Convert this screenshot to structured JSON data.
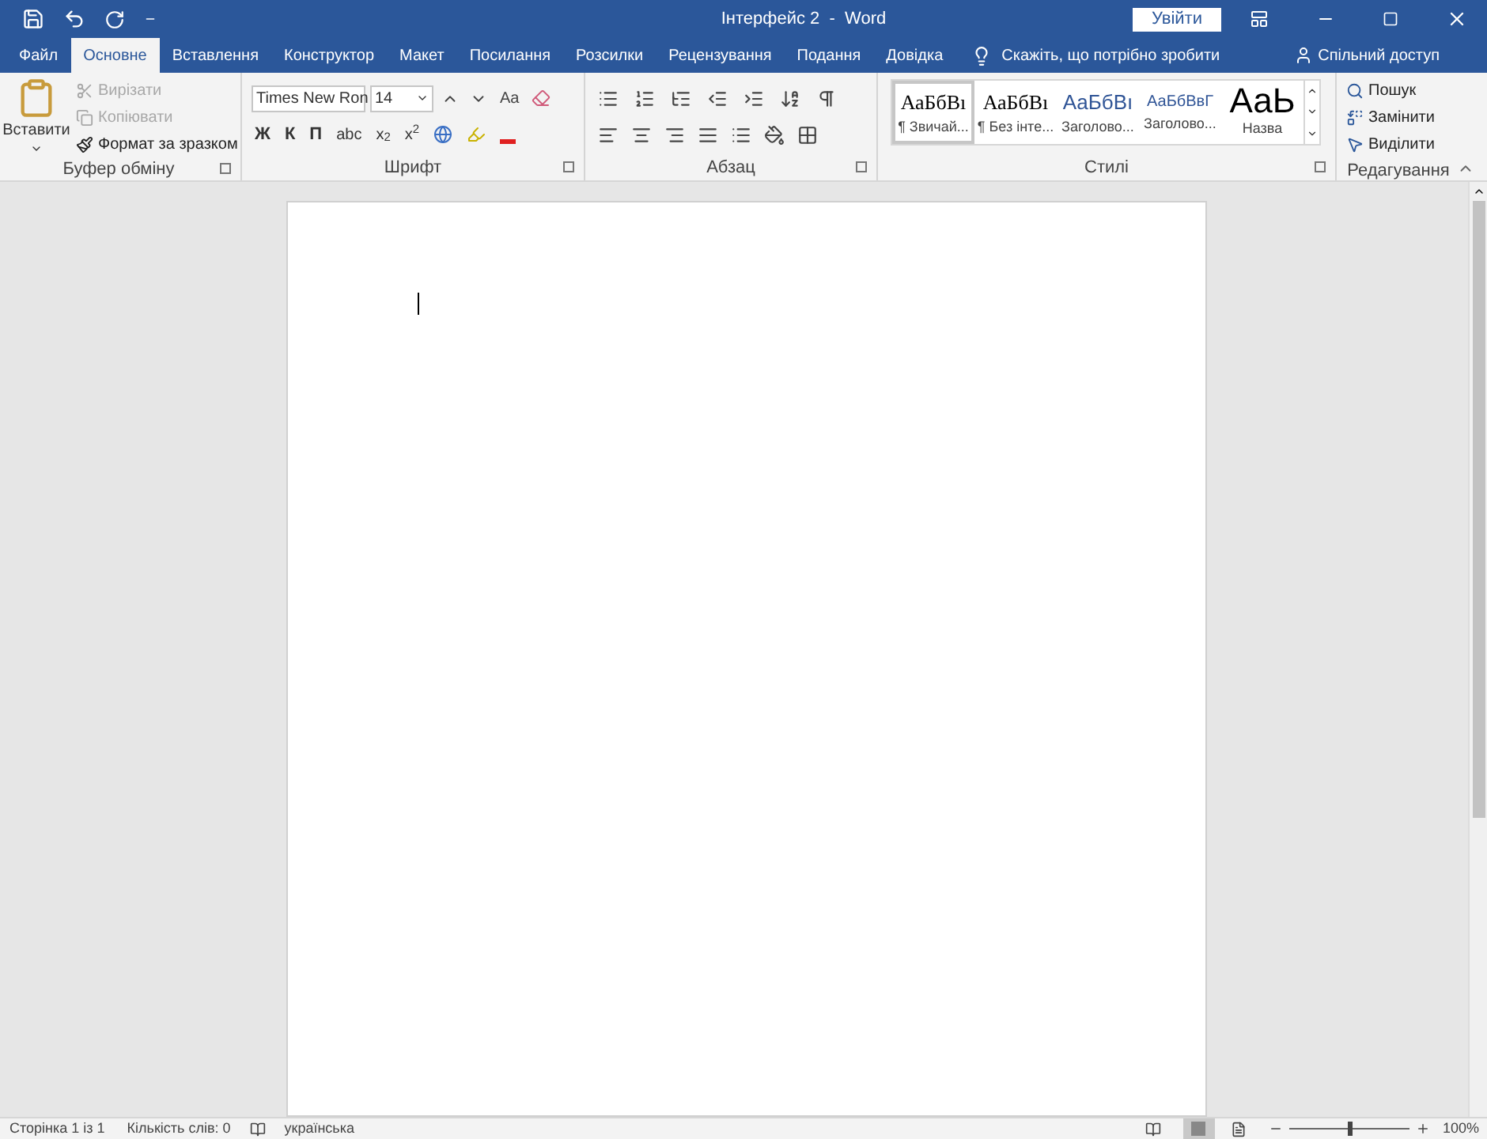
{
  "title_bar": {
    "title": "Інтерфейс 2  -  Word",
    "sign_in": "Увійти"
  },
  "tabs": [
    {
      "label": "Файл",
      "selected": false
    },
    {
      "label": "Основне",
      "selected": true
    },
    {
      "label": "Вставлення",
      "selected": false
    },
    {
      "label": "Конструктор",
      "selected": false
    },
    {
      "label": "Макет",
      "selected": false
    },
    {
      "label": "Посилання",
      "selected": false
    },
    {
      "label": "Розсилки",
      "selected": false
    },
    {
      "label": "Рецензування",
      "selected": false
    },
    {
      "label": "Подання",
      "selected": false
    },
    {
      "label": "Довідка",
      "selected": false
    }
  ],
  "tell_me": "Скажіть, що потрібно зробити",
  "share": "Спільний доступ",
  "clipboard": {
    "paste": "Вставити",
    "items": [
      {
        "label": "Вирізати",
        "disabled": true
      },
      {
        "label": "Копіювати",
        "disabled": true
      },
      {
        "label": "Формат за зразком",
        "disabled": false
      }
    ],
    "group_label": "Буфер обміну"
  },
  "font": {
    "font_name": "Times New Ron",
    "font_size": "14",
    "case_button": "Aa",
    "format_buttons": [
      "Ж",
      "К",
      "П",
      "abc",
      "x$_{2}$",
      "x$^{2}$"
    ],
    "group_label": "Шрифт"
  },
  "paragraph": {
    "group_label": "Абзац"
  },
  "styles": {
    "items": [
      {
        "preview": "АаБбВı",
        "name": "¶ Звичай...",
        "selected": true,
        "kind": "normal"
      },
      {
        "preview": "АаБбВı",
        "name": "¶ Без інте...",
        "selected": false,
        "kind": "normal"
      },
      {
        "preview": "АаБбВı",
        "name": "Заголово...",
        "selected": false,
        "kind": "heading1"
      },
      {
        "preview": "АаБбВвГ",
        "name": "Заголово...",
        "selected": false,
        "kind": "heading2"
      },
      {
        "preview": "АаЬ",
        "name": "Назва",
        "selected": false,
        "kind": "title"
      }
    ],
    "group_label": "Стилі"
  },
  "editing": {
    "items": [
      {
        "label": "Пошук",
        "kind": "find"
      },
      {
        "label": "Замінити",
        "kind": "replace"
      },
      {
        "label": "Виділити",
        "kind": "select"
      }
    ],
    "group_label": "Редагування"
  },
  "status_bar": {
    "page": "Сторінка 1 із 1",
    "words": "Кількість слів: 0",
    "language": "українська",
    "zoom": "100%",
    "zoom_slider": {
      "level": 0.5
    }
  }
}
